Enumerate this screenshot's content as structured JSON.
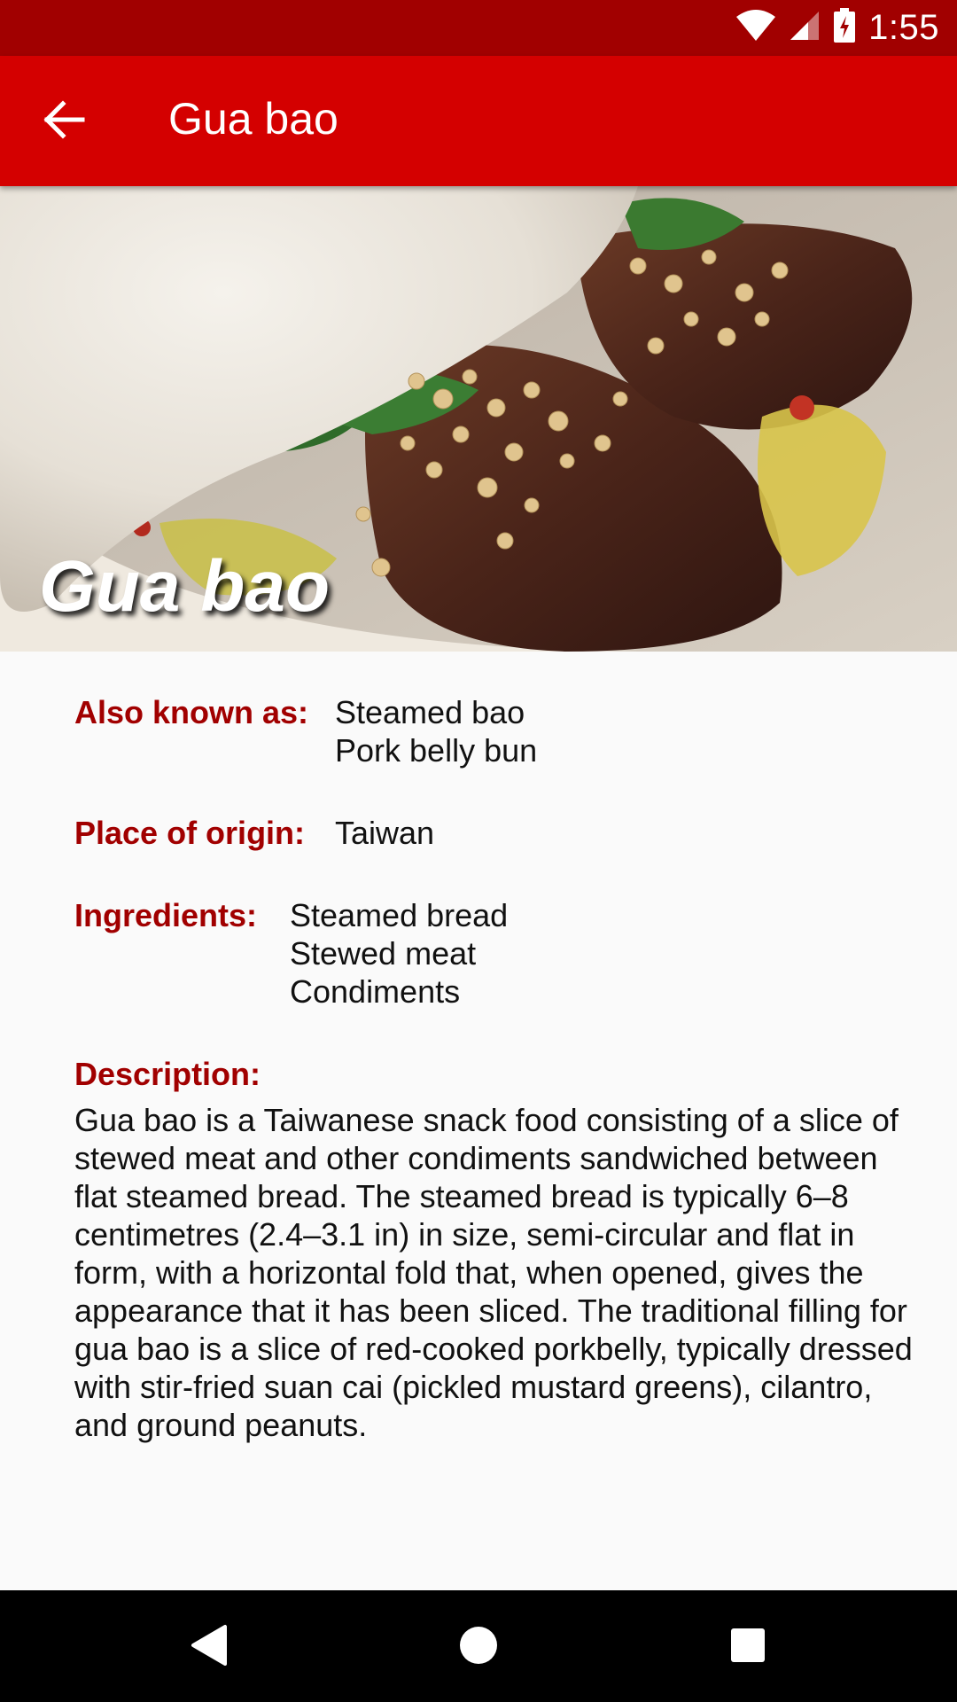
{
  "status_bar": {
    "time": "1:55",
    "icons": [
      "wifi-icon",
      "cell-signal-icon",
      "battery-charging-icon"
    ]
  },
  "app_bar": {
    "title": "Gua bao",
    "back_icon": "arrow-back-icon",
    "color": "#d40000"
  },
  "hero": {
    "title": "Gua bao"
  },
  "details": {
    "also_known_as": {
      "label": "Also known as:",
      "values": [
        "Steamed bao",
        "Pork belly bun"
      ]
    },
    "place_of_origin": {
      "label": "Place of origin:",
      "values": [
        "Taiwan"
      ]
    },
    "ingredients": {
      "label": "Ingredients:",
      "values": [
        "Steamed bread",
        "Stewed meat",
        "Condiments"
      ]
    },
    "description": {
      "label": "Description:",
      "text": "Gua bao is a Taiwanese snack food consisting of a slice of stewed meat and other condiments sandwiched between flat steamed bread. The steamed bread is typically 6–8 centimetres (2.4–3.1 in) in size, semi-circular and flat in form, with a horizontal fold that, when opened, gives the appearance that it has been sliced. The traditional filling for gua bao is a slice of red-cooked porkbelly, typically dressed with stir-fried suan cai (pickled mustard greens), cilantro, and ground peanuts."
    }
  },
  "nav_bar": {
    "buttons": [
      "back-triangle-icon",
      "home-circle-icon",
      "recents-square-icon"
    ]
  },
  "colors": {
    "status_bar": "#a10000",
    "app_bar": "#d40000",
    "label": "#a10000",
    "background": "#fafafa"
  }
}
